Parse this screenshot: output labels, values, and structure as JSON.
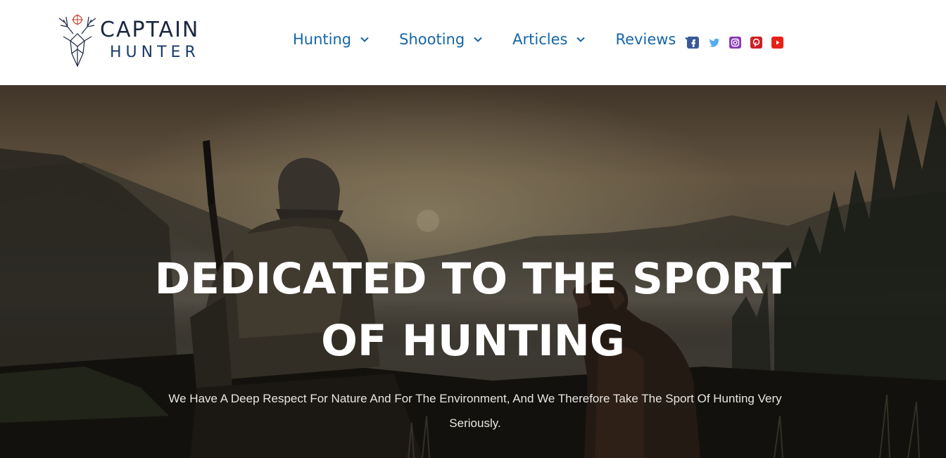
{
  "brand": {
    "line1": "CAPTAIN",
    "line2": "HUNTER",
    "logo_icon": "deer-head-crosshair-icon"
  },
  "nav": {
    "items": [
      {
        "label": "Hunting",
        "icon": "chevron-down-icon"
      },
      {
        "label": "Shooting",
        "icon": "chevron-down-icon"
      },
      {
        "label": "Articles",
        "icon": "chevron-down-icon"
      },
      {
        "label": "Reviews",
        "icon": "chevron-down-icon"
      }
    ],
    "color": "#1566a8"
  },
  "social": [
    {
      "icon": "facebook-icon",
      "color": "#3b5998"
    },
    {
      "icon": "twitter-icon",
      "color": "#55acee"
    },
    {
      "icon": "instagram-icon",
      "color": "#8a3ab9"
    },
    {
      "icon": "pinterest-icon",
      "color": "#cb2027"
    },
    {
      "icon": "youtube-icon",
      "color": "#e62117"
    }
  ],
  "hero": {
    "title_line1": "DEDICATED TO THE SPORT",
    "title_line2": "OF HUNTING",
    "subtitle": "We Have A Deep Respect For Nature And For The Environment, And We Therefore Take The Sport Of Hunting Very Seriously."
  }
}
